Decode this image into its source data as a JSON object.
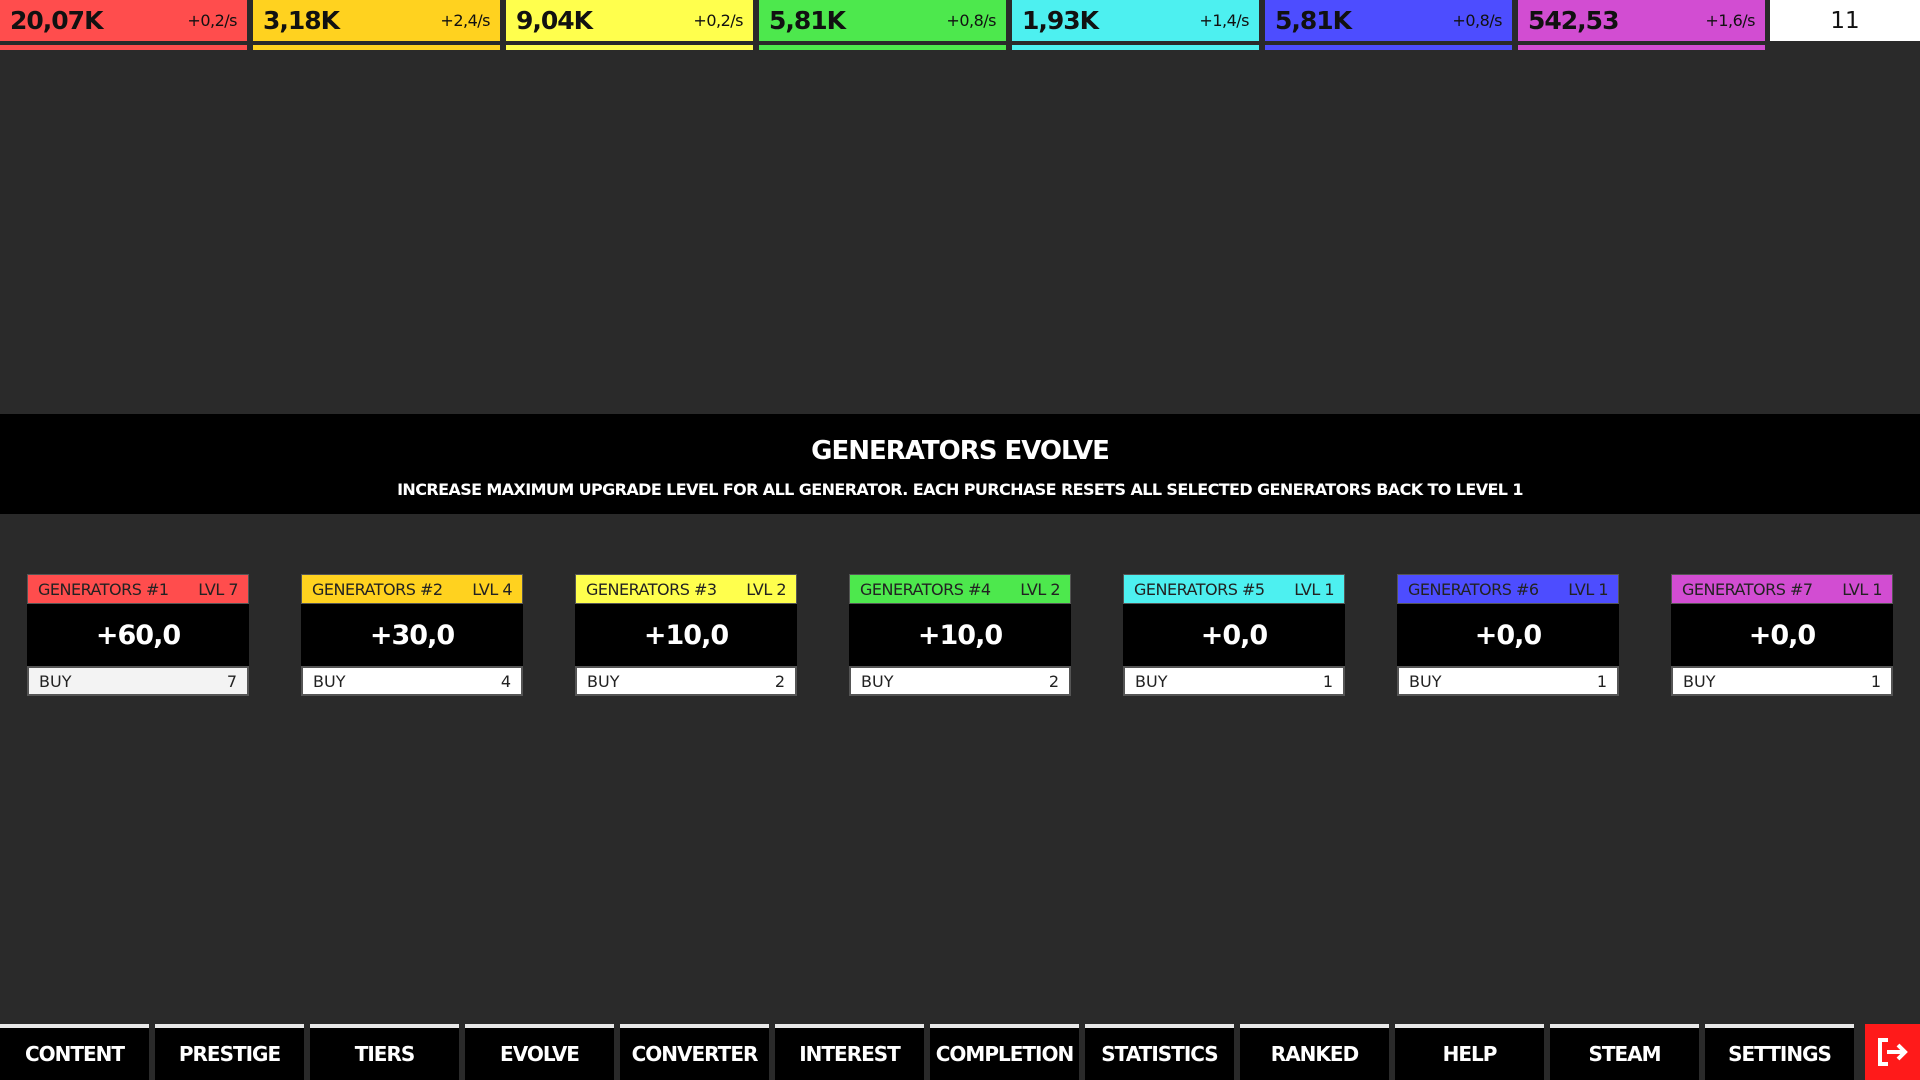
{
  "resources": [
    {
      "amount": "20,07K",
      "rate": "+0,2/s",
      "color": "#ff4d4d"
    },
    {
      "amount": "3,18K",
      "rate": "+2,4/s",
      "color": "#ffd21f"
    },
    {
      "amount": "9,04K",
      "rate": "+0,2/s",
      "color": "#ffff4d"
    },
    {
      "amount": "5,81K",
      "rate": "+0,8/s",
      "color": "#4de84d"
    },
    {
      "amount": "1,93K",
      "rate": "+1,4/s",
      "color": "#4df0f0"
    },
    {
      "amount": "5,81K",
      "rate": "+0,8/s",
      "color": "#4d4dff"
    },
    {
      "amount": "542,53",
      "rate": "+1,6/s",
      "color": "#d24dd2"
    }
  ],
  "counter": "11",
  "banner": {
    "title": "GENERATORS EVOLVE",
    "description": "INCREASE MAXIMUM UPGRADE LEVEL FOR ALL GENERATOR. EACH PURCHASE RESETS ALL SELECTED GENERATORS BACK TO LEVEL 1"
  },
  "generators": [
    {
      "name": "GENERATORS #1",
      "level": "LVL 7",
      "value": "+60,0",
      "buy_label": "BUY",
      "buy_count": "7",
      "color": "#ff4d4d"
    },
    {
      "name": "GENERATORS #2",
      "level": "LVL 4",
      "value": "+30,0",
      "buy_label": "BUY",
      "buy_count": "4",
      "color": "#ffd21f"
    },
    {
      "name": "GENERATORS #3",
      "level": "LVL 2",
      "value": "+10,0",
      "buy_label": "BUY",
      "buy_count": "2",
      "color": "#ffff4d"
    },
    {
      "name": "GENERATORS #4",
      "level": "LVL 2",
      "value": "+10,0",
      "buy_label": "BUY",
      "buy_count": "2",
      "color": "#4de84d"
    },
    {
      "name": "GENERATORS #5",
      "level": "LVL 1",
      "value": "+0,0",
      "buy_label": "BUY",
      "buy_count": "1",
      "color": "#4df0f0"
    },
    {
      "name": "GENERATORS #6",
      "level": "LVL 1",
      "value": "+0,0",
      "buy_label": "BUY",
      "buy_count": "1",
      "color": "#4d4dff"
    },
    {
      "name": "GENERATORS #7",
      "level": "LVL 1",
      "value": "+0,0",
      "buy_label": "BUY",
      "buy_count": "1",
      "color": "#d24dd2"
    }
  ],
  "nav": [
    "CONTENT",
    "PRESTIGE",
    "TIERS",
    "EVOLVE",
    "CONVERTER",
    "INTEREST",
    "COMPLETION",
    "STATISTICS",
    "RANKED",
    "HELP",
    "STEAM",
    "SETTINGS"
  ],
  "exit_icon": "exit-icon",
  "exit_color": "#ff1a1a"
}
